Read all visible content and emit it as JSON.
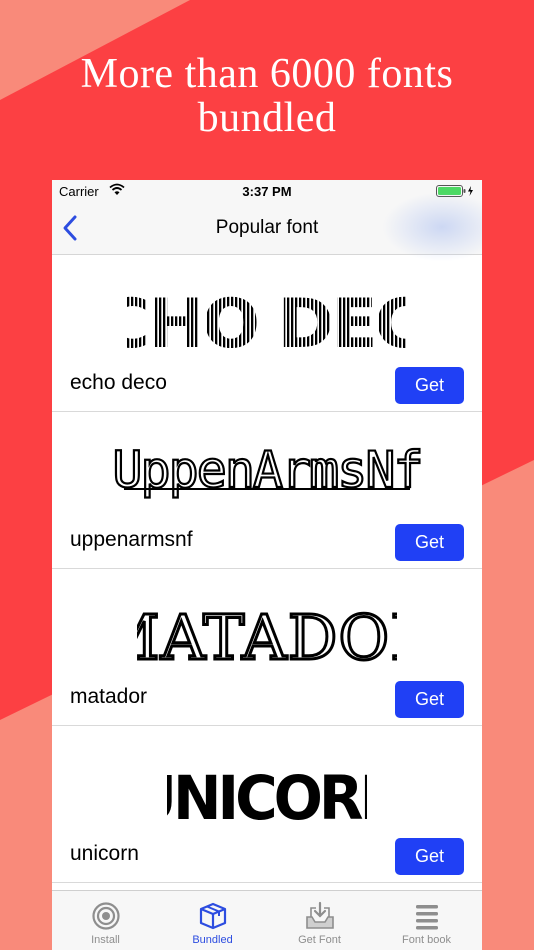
{
  "promo": {
    "headline_line1": "More than 6000 fonts",
    "headline_line2": "bundled"
  },
  "status_bar": {
    "carrier": "Carrier",
    "time": "3:37 PM"
  },
  "nav": {
    "title": "Popular font"
  },
  "fonts": [
    {
      "preview": "ECHO DECO",
      "name": "echo deco",
      "button": "Get"
    },
    {
      "preview": "UppenArmsNf",
      "name": "uppenarmsnf",
      "button": "Get"
    },
    {
      "preview": "MATADOR",
      "name": "matador",
      "button": "Get"
    },
    {
      "preview": "UNICORN",
      "name": "unicorn",
      "button": "Get"
    }
  ],
  "tabbar": {
    "items": [
      {
        "label": "Install",
        "icon": "target-icon",
        "active": false
      },
      {
        "label": "Bundled",
        "icon": "box-icon",
        "active": true
      },
      {
        "label": "Get Font",
        "icon": "download-tray-icon",
        "active": false
      },
      {
        "label": "Font book",
        "icon": "list-icon",
        "active": false
      }
    ]
  },
  "colors": {
    "background_red": "#fc4043",
    "background_salmon": "#f98a7a",
    "accent_blue": "#2040f5",
    "tab_active": "#2d4de0"
  }
}
